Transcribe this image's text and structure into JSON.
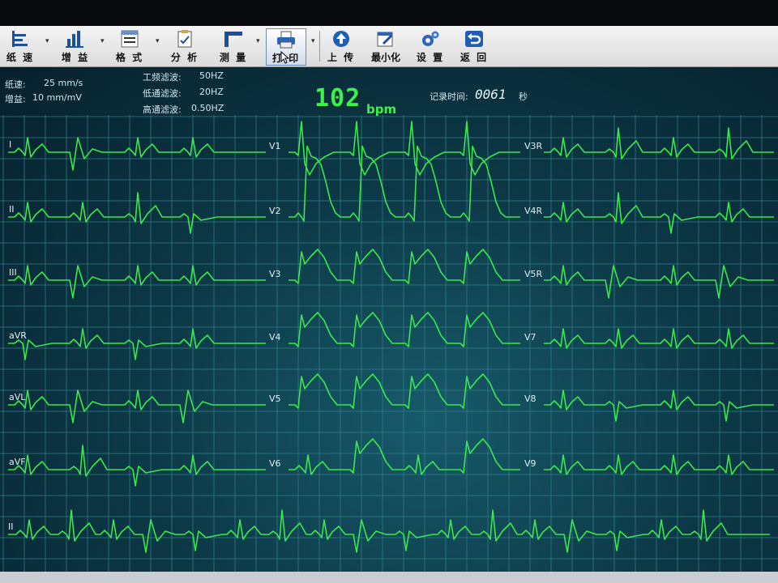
{
  "toolbar": {
    "buttons": [
      {
        "label": "纸 速",
        "icon": "paper-speed-icon"
      },
      {
        "label": "增 益",
        "icon": "gain-icon"
      },
      {
        "label": "格 式",
        "icon": "format-icon"
      },
      {
        "label": "分 析",
        "icon": "analysis-icon"
      },
      {
        "label": "测 量",
        "icon": "measure-icon"
      },
      {
        "label": "打 印",
        "icon": "printer-icon"
      },
      {
        "label": "上 传",
        "icon": "upload-icon"
      },
      {
        "label": "最小化",
        "icon": "minimize-icon"
      },
      {
        "label": "设 置",
        "icon": "gear-icon"
      },
      {
        "label": "返 回",
        "icon": "back-icon"
      }
    ]
  },
  "settings": {
    "paper_speed_label": "纸速:",
    "paper_speed_value": "25 mm/s",
    "gain_label": "增益:",
    "gain_value": "10 mm/mV",
    "powerline_filter_label": "工频滤波:",
    "powerline_filter_value": "50HZ",
    "lowpass_filter_label": "低通滤波:",
    "lowpass_filter_value": "20HZ",
    "highpass_filter_label": "高通滤波:",
    "highpass_filter_value": "0.50HZ"
  },
  "heart_rate": {
    "value": "102",
    "unit": "bpm"
  },
  "record_time": {
    "label": "记录时间:",
    "value": "0061",
    "unit": "秒"
  },
  "leads": {
    "left": [
      "I",
      "II",
      "III",
      "aVR",
      "aVL",
      "aVF"
    ],
    "middle": [
      "V1",
      "V2",
      "V3",
      "V4",
      "V5",
      "V6"
    ],
    "right": [
      "V3R",
      "V4R",
      "V5R",
      "V7",
      "V8",
      "V9"
    ],
    "rhythm": "II"
  },
  "colors": {
    "trace": "#39e84a",
    "grid": "#2f7e8c",
    "heart_rate": "#3cf24a"
  }
}
